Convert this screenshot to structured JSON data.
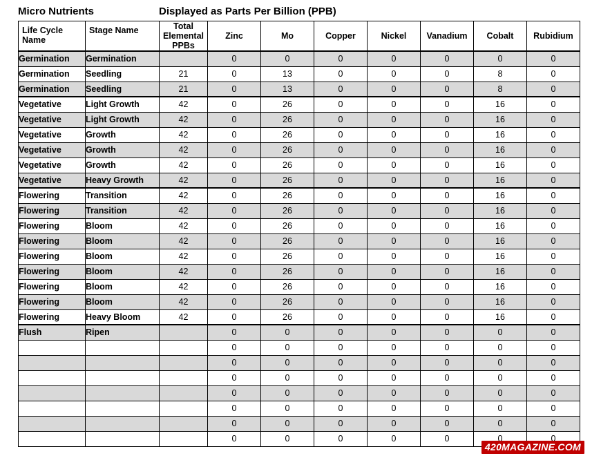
{
  "header": {
    "left_title": "Micro Nutrients",
    "right_title": "Displayed as Parts Per Billion (PPB)"
  },
  "watermark": "420MAGAZINE.COM",
  "table": {
    "columns": [
      "Life Cycle Name",
      "Stage Name",
      "Total Elemental PPBs",
      "Zinc",
      "Mo",
      "Copper",
      "Nickel",
      "Vanadium",
      "Cobalt",
      "Rubidium"
    ],
    "rows": [
      {
        "shade": true,
        "group_top": true,
        "cells": [
          "Germination",
          "Germination",
          "",
          "0",
          "0",
          "0",
          "0",
          "0",
          "0",
          "0"
        ]
      },
      {
        "shade": false,
        "group_top": false,
        "cells": [
          "Germination",
          "Seedling",
          "21",
          "0",
          "13",
          "0",
          "0",
          "0",
          "8",
          "0"
        ]
      },
      {
        "shade": true,
        "group_top": false,
        "cells": [
          "Germination",
          "Seedling",
          "21",
          "0",
          "13",
          "0",
          "0",
          "0",
          "8",
          "0"
        ]
      },
      {
        "shade": false,
        "group_top": true,
        "cells": [
          "Vegetative",
          "Light Growth",
          "42",
          "0",
          "26",
          "0",
          "0",
          "0",
          "16",
          "0"
        ]
      },
      {
        "shade": true,
        "group_top": false,
        "cells": [
          "Vegetative",
          "Light Growth",
          "42",
          "0",
          "26",
          "0",
          "0",
          "0",
          "16",
          "0"
        ]
      },
      {
        "shade": false,
        "group_top": false,
        "cells": [
          "Vegetative",
          "Growth",
          "42",
          "0",
          "26",
          "0",
          "0",
          "0",
          "16",
          "0"
        ]
      },
      {
        "shade": true,
        "group_top": false,
        "cells": [
          "Vegetative",
          "Growth",
          "42",
          "0",
          "26",
          "0",
          "0",
          "0",
          "16",
          "0"
        ]
      },
      {
        "shade": false,
        "group_top": false,
        "cells": [
          "Vegetative",
          "Growth",
          "42",
          "0",
          "26",
          "0",
          "0",
          "0",
          "16",
          "0"
        ]
      },
      {
        "shade": true,
        "group_top": false,
        "cells": [
          "Vegetative",
          "Heavy Growth",
          "42",
          "0",
          "26",
          "0",
          "0",
          "0",
          "16",
          "0"
        ]
      },
      {
        "shade": false,
        "group_top": true,
        "cells": [
          "Flowering",
          "Transition",
          "42",
          "0",
          "26",
          "0",
          "0",
          "0",
          "16",
          "0"
        ]
      },
      {
        "shade": true,
        "group_top": false,
        "cells": [
          "Flowering",
          "Transition",
          "42",
          "0",
          "26",
          "0",
          "0",
          "0",
          "16",
          "0"
        ]
      },
      {
        "shade": false,
        "group_top": false,
        "cells": [
          "Flowering",
          "Bloom",
          "42",
          "0",
          "26",
          "0",
          "0",
          "0",
          "16",
          "0"
        ]
      },
      {
        "shade": true,
        "group_top": false,
        "cells": [
          "Flowering",
          "Bloom",
          "42",
          "0",
          "26",
          "0",
          "0",
          "0",
          "16",
          "0"
        ]
      },
      {
        "shade": false,
        "group_top": false,
        "cells": [
          "Flowering",
          "Bloom",
          "42",
          "0",
          "26",
          "0",
          "0",
          "0",
          "16",
          "0"
        ]
      },
      {
        "shade": true,
        "group_top": false,
        "cells": [
          "Flowering",
          "Bloom",
          "42",
          "0",
          "26",
          "0",
          "0",
          "0",
          "16",
          "0"
        ]
      },
      {
        "shade": false,
        "group_top": false,
        "cells": [
          "Flowering",
          "Bloom",
          "42",
          "0",
          "26",
          "0",
          "0",
          "0",
          "16",
          "0"
        ]
      },
      {
        "shade": true,
        "group_top": false,
        "cells": [
          "Flowering",
          "Bloom",
          "42",
          "0",
          "26",
          "0",
          "0",
          "0",
          "16",
          "0"
        ]
      },
      {
        "shade": false,
        "group_top": false,
        "cells": [
          "Flowering",
          "Heavy Bloom",
          "42",
          "0",
          "26",
          "0",
          "0",
          "0",
          "16",
          "0"
        ]
      },
      {
        "shade": true,
        "group_top": true,
        "cells": [
          "Flush",
          "Ripen",
          "",
          "0",
          "0",
          "0",
          "0",
          "0",
          "0",
          "0"
        ]
      },
      {
        "shade": false,
        "group_top": false,
        "cells": [
          "",
          "",
          "",
          "0",
          "0",
          "0",
          "0",
          "0",
          "0",
          "0"
        ]
      },
      {
        "shade": true,
        "group_top": false,
        "cells": [
          "",
          "",
          "",
          "0",
          "0",
          "0",
          "0",
          "0",
          "0",
          "0"
        ]
      },
      {
        "shade": false,
        "group_top": false,
        "cells": [
          "",
          "",
          "",
          "0",
          "0",
          "0",
          "0",
          "0",
          "0",
          "0"
        ]
      },
      {
        "shade": true,
        "group_top": false,
        "cells": [
          "",
          "",
          "",
          "0",
          "0",
          "0",
          "0",
          "0",
          "0",
          "0"
        ]
      },
      {
        "shade": false,
        "group_top": false,
        "cells": [
          "",
          "",
          "",
          "0",
          "0",
          "0",
          "0",
          "0",
          "0",
          "0"
        ]
      },
      {
        "shade": true,
        "group_top": false,
        "cells": [
          "",
          "",
          "",
          "0",
          "0",
          "0",
          "0",
          "0",
          "0",
          "0"
        ]
      },
      {
        "shade": false,
        "group_top": false,
        "cells": [
          "",
          "",
          "",
          "0",
          "0",
          "0",
          "0",
          "0",
          "0",
          "0"
        ]
      }
    ]
  }
}
